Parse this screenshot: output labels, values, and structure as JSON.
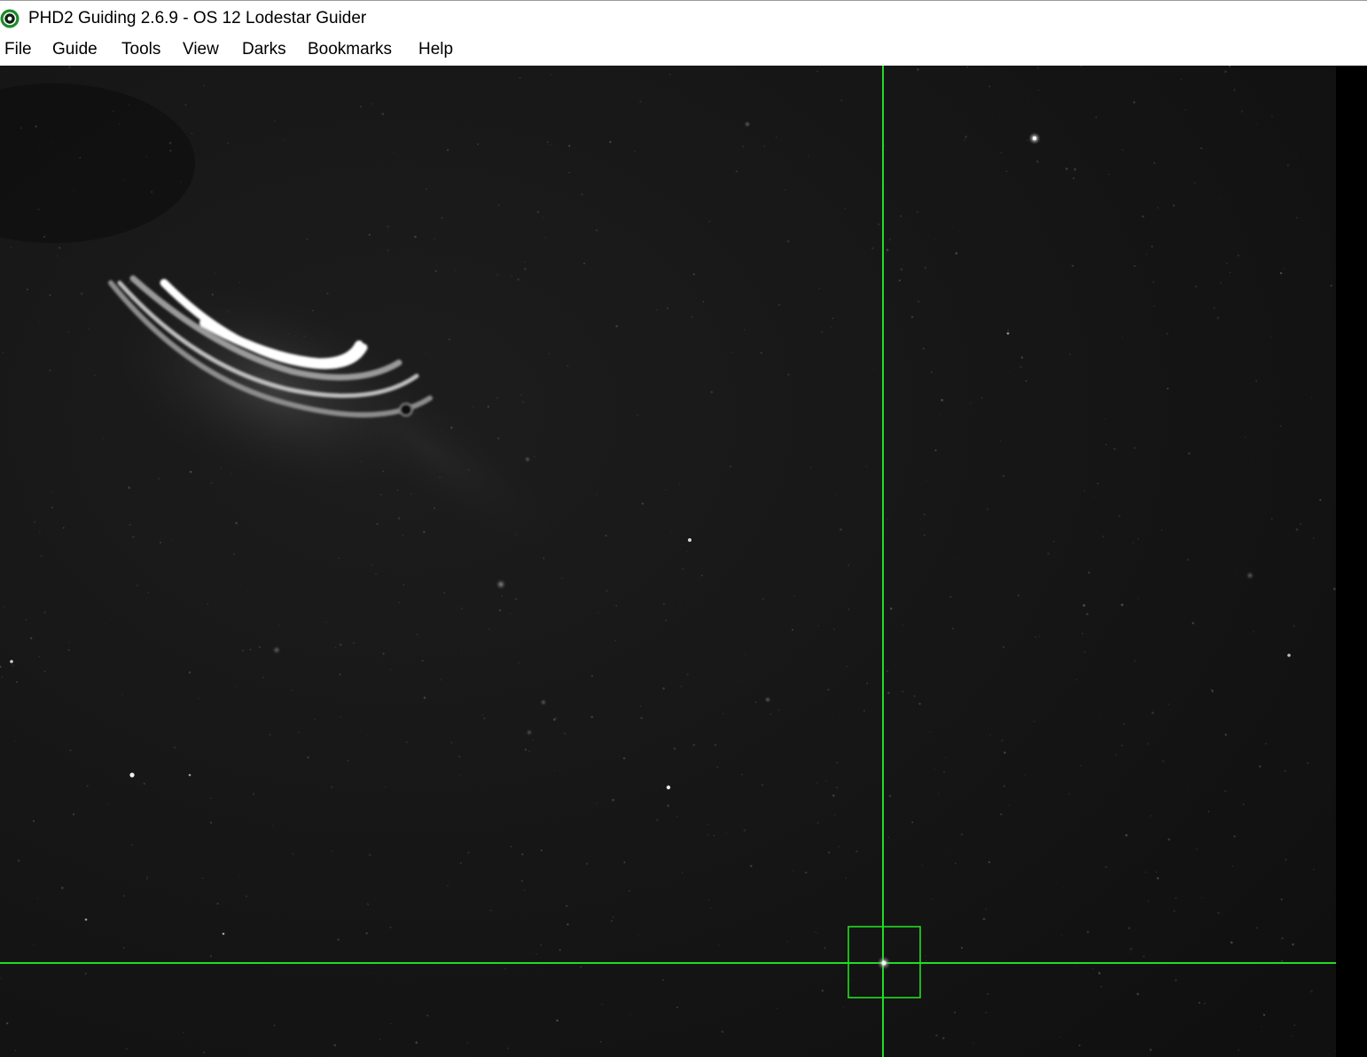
{
  "window": {
    "title": "PHD2 Guiding 2.6.9 - OS 12 Lodestar Guider",
    "icon": "phd2-target-icon"
  },
  "menubar": {
    "items": [
      {
        "label": "File"
      },
      {
        "label": "Guide"
      },
      {
        "label": "Tools"
      },
      {
        "label": "View"
      },
      {
        "label": "Darks"
      },
      {
        "label": "Bookmarks"
      },
      {
        "label": "Help"
      }
    ]
  },
  "overlay": {
    "reticle_color": "#22dd22",
    "reticle": "crosshair",
    "selection": "star-selection-box"
  }
}
